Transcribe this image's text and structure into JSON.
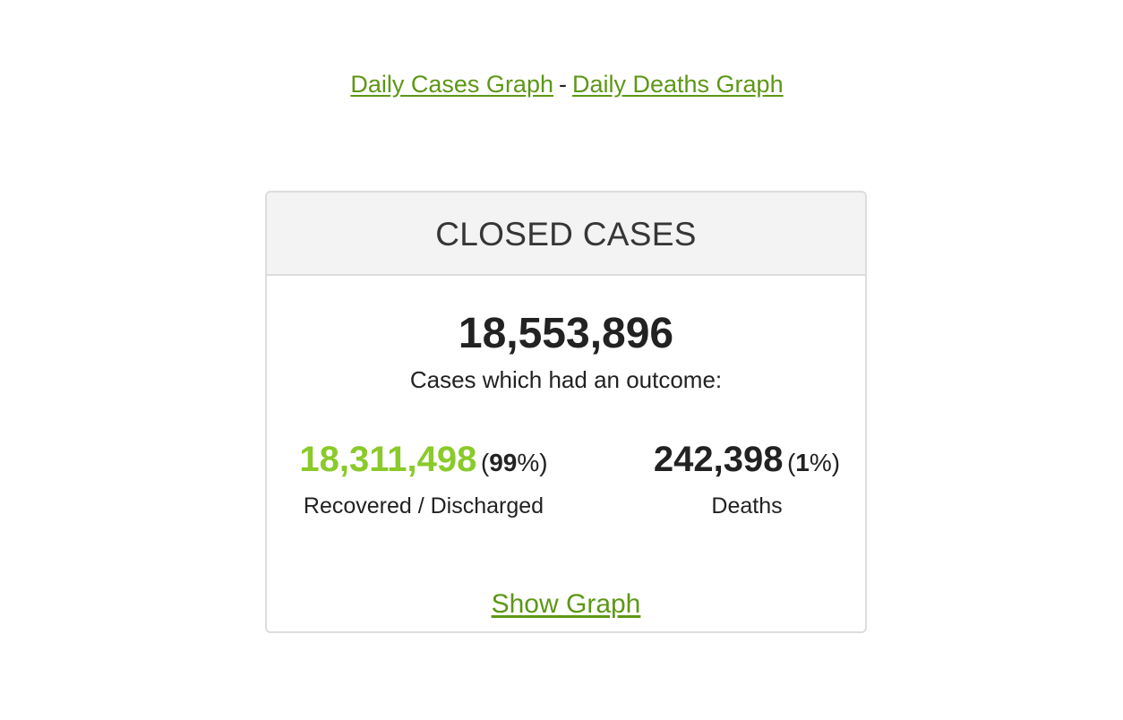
{
  "links": {
    "daily_cases": "Daily Cases Graph",
    "separator": "-",
    "daily_deaths": "Daily Deaths Graph"
  },
  "card": {
    "title": "CLOSED CASES",
    "total": "18,553,896",
    "total_label": "Cases which had an outcome:",
    "recovered": {
      "value": "18,311,498",
      "pct_open": "(",
      "pct": "99",
      "pct_close": "%)",
      "label": "Recovered / Discharged"
    },
    "deaths": {
      "value": "242,398",
      "pct_open": "(",
      "pct": "1",
      "pct_close": "%)",
      "label": "Deaths"
    },
    "show_graph": "Show Graph"
  },
  "colors": {
    "link": "#5d9716",
    "recovered": "#8aca2b",
    "header_bg": "#f3f3f3",
    "border": "#dddddd"
  }
}
